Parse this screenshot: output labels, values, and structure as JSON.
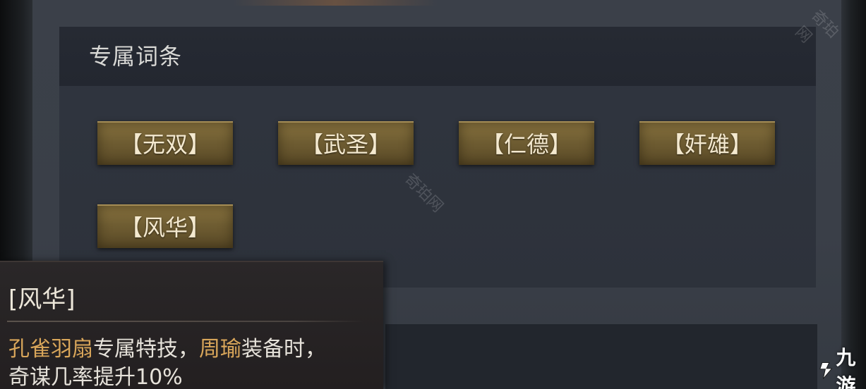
{
  "section": {
    "title": "专属词条"
  },
  "tags": [
    {
      "label": "【无双】"
    },
    {
      "label": "【武圣】"
    },
    {
      "label": "【仁德】"
    },
    {
      "label": "【奸雄】"
    },
    {
      "label": "【风华】"
    }
  ],
  "tooltip": {
    "title": "[风华]",
    "line1_highlight_a": "孔雀羽扇",
    "line1_text_a": "专属特技，",
    "line1_highlight_b": "周瑜",
    "line1_text_b": "装备时，",
    "line2": "奇谋几率提升10%"
  },
  "watermarks": [
    "奇珀网",
    "奇珀网"
  ],
  "brand": {
    "text": "九游"
  },
  "colors": {
    "highlight": "#d9a65a",
    "tag_gold": "#8a7440",
    "panel": "#3a3f48"
  }
}
